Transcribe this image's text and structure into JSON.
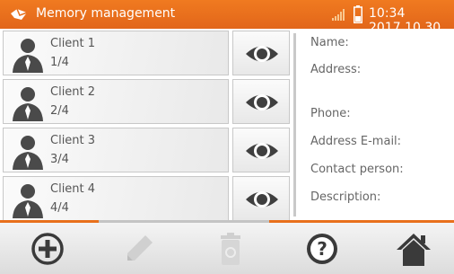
{
  "header": {
    "title": "Memory management",
    "datetime": "10:34 2017.10.30",
    "app_icon": "controller-icon",
    "signal_icon": "signal-icon",
    "battery_icon": "battery-icon",
    "background": "#e8701c"
  },
  "clients": [
    {
      "name": "Client 1",
      "index": "1/4"
    },
    {
      "name": "Client 2",
      "index": "2/4"
    },
    {
      "name": "Client 3",
      "index": "3/4"
    },
    {
      "name": "Client 4",
      "index": "4/4"
    }
  ],
  "details": {
    "name_label": "Name:",
    "address_label": "Address:",
    "phone_label": "Phone:",
    "email_label": "Address E-mail:",
    "contact_label": "Contact person:",
    "description_label": "Description:"
  },
  "toolbar": {
    "icons": [
      "add-icon",
      "edit-icon",
      "trash-icon",
      "help-icon",
      "home-icon"
    ],
    "accent": "#e8701c"
  }
}
